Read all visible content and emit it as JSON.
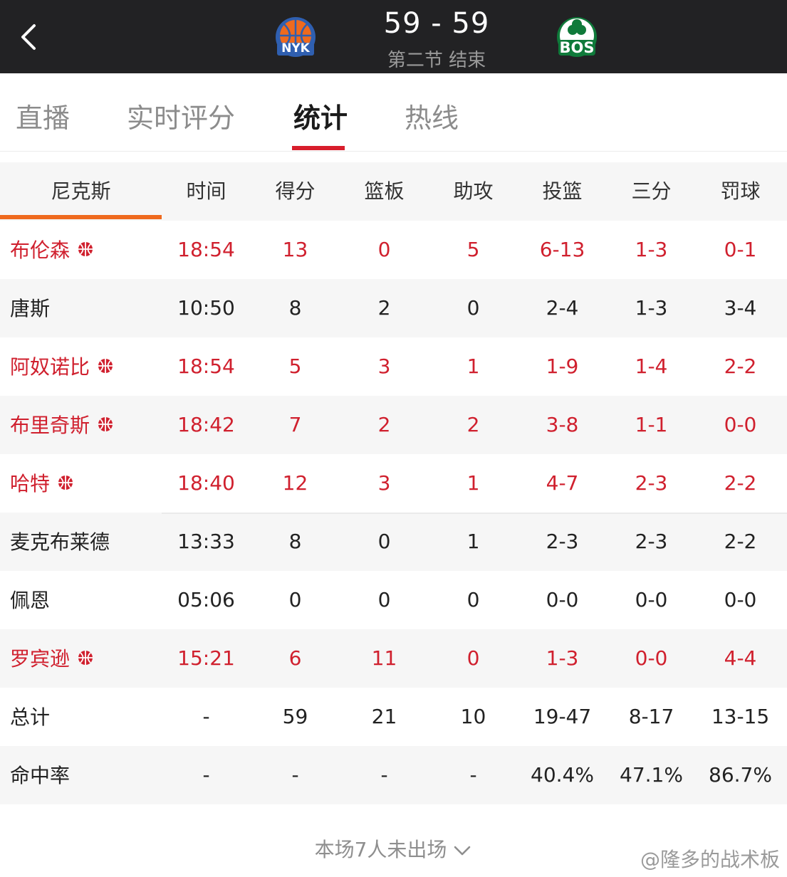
{
  "header": {
    "home_abbr": "NYK",
    "away_abbr": "BOS",
    "score": "59 - 59",
    "period": "第二节 结束"
  },
  "colors": {
    "header_bg": "#222224",
    "accent_red": "#d81e2c",
    "team_orange": "#ef6a1e",
    "knicks_blue": "#2f5fb0",
    "celtics_green": "#0f7a3a"
  },
  "tabs": [
    {
      "label": "直播"
    },
    {
      "label": "实时评分"
    },
    {
      "label": "统计",
      "active": true
    },
    {
      "label": "热线"
    }
  ],
  "table": {
    "team": "尼克斯",
    "columns": [
      "时间",
      "得分",
      "篮板",
      "助攻",
      "投篮",
      "三分",
      "罚球"
    ],
    "rows": [
      {
        "name": "布伦森",
        "starter": true,
        "cells": [
          "18:54",
          "13",
          "0",
          "5",
          "6-13",
          "1-3",
          "0-1"
        ]
      },
      {
        "name": "唐斯",
        "starter": false,
        "cells": [
          "10:50",
          "8",
          "2",
          "0",
          "2-4",
          "1-3",
          "3-4"
        ]
      },
      {
        "name": "阿奴诺比",
        "starter": true,
        "cells": [
          "18:54",
          "5",
          "3",
          "1",
          "1-9",
          "1-4",
          "2-2"
        ]
      },
      {
        "name": "布里奇斯",
        "starter": true,
        "cells": [
          "18:42",
          "7",
          "2",
          "2",
          "3-8",
          "1-1",
          "0-0"
        ]
      },
      {
        "name": "哈特",
        "starter": true,
        "cells": [
          "18:40",
          "12",
          "3",
          "1",
          "4-7",
          "2-3",
          "2-2"
        ]
      },
      {
        "name": "麦克布莱德",
        "starter": false,
        "cells": [
          "13:33",
          "8",
          "0",
          "1",
          "2-3",
          "2-3",
          "2-2"
        ]
      },
      {
        "name": "佩恩",
        "starter": false,
        "cells": [
          "05:06",
          "0",
          "0",
          "0",
          "0-0",
          "0-0",
          "0-0"
        ]
      },
      {
        "name": "罗宾逊",
        "starter": true,
        "cells": [
          "15:21",
          "6",
          "11",
          "0",
          "1-3",
          "0-0",
          "4-4"
        ]
      },
      {
        "name": "总计",
        "starter": false,
        "cells": [
          "-",
          "59",
          "21",
          "10",
          "19-47",
          "8-17",
          "13-15"
        ]
      },
      {
        "name": "命中率",
        "starter": false,
        "cells": [
          "-",
          "-",
          "-",
          "-",
          "40.4%",
          "47.1%",
          "86.7%"
        ]
      }
    ]
  },
  "bench_note": "本场7人未出场",
  "watermark": "@隆多的战术板",
  "icons": {
    "back": "chevron-left-icon",
    "starter": "basketball-icon",
    "expand": "chevron-down-icon"
  }
}
